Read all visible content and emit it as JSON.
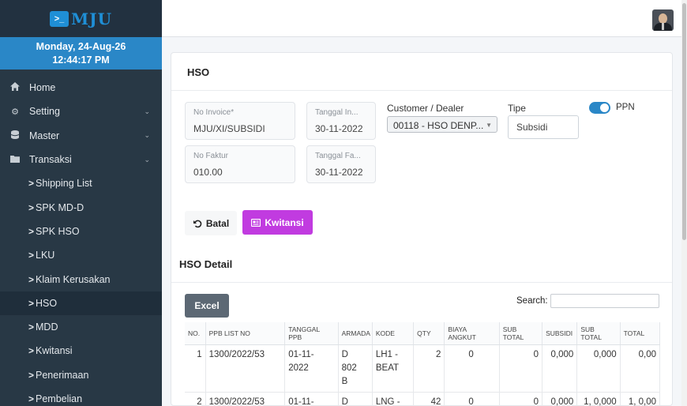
{
  "brand": {
    "logo_text": "MJU",
    "logo_icon": "terminal-icon"
  },
  "datetime": {
    "date": "Monday, 24-Aug-26",
    "time": "12:44:17 PM"
  },
  "nav": [
    {
      "label": "Home",
      "icon": "home-icon",
      "type": "top"
    },
    {
      "label": "Setting",
      "icon": "gears-icon",
      "type": "top",
      "chevron": "⌄"
    },
    {
      "label": "Master",
      "icon": "database-icon",
      "type": "top",
      "chevron": "⌄"
    },
    {
      "label": "Transaksi",
      "icon": "folder-icon",
      "type": "top",
      "chevron": "⌄"
    },
    {
      "label": "Shipping List",
      "type": "sub"
    },
    {
      "label": "SPK MD-D",
      "type": "sub"
    },
    {
      "label": "SPK HSO",
      "type": "sub"
    },
    {
      "label": "LKU",
      "type": "sub"
    },
    {
      "label": "Klaim Kerusakan",
      "type": "sub"
    },
    {
      "label": "HSO",
      "type": "sub",
      "active": true
    },
    {
      "label": "MDD",
      "type": "sub"
    },
    {
      "label": "Kwitansi",
      "type": "sub"
    },
    {
      "label": "Penerimaan",
      "type": "sub"
    },
    {
      "label": "Pembelian",
      "type": "sub"
    }
  ],
  "card": {
    "title": "HSO"
  },
  "form": {
    "no_invoice": {
      "label": "No Invoice*",
      "value": "MJU/XI/SUBSIDI"
    },
    "tanggal_invoice": {
      "label": "Tanggal In...",
      "value": "30-11-2022"
    },
    "no_faktur": {
      "label": "No Faktur",
      "value": "010.00"
    },
    "tanggal_faktur": {
      "label": "Tanggal Fa...",
      "value": "30-11-2022"
    },
    "customer": {
      "label": "Customer / Dealer",
      "value": "00118 - HSO DENP..."
    },
    "tipe": {
      "label": "Tipe",
      "value": "Subsidi"
    },
    "ppn": {
      "label": "PPN",
      "on": true
    }
  },
  "buttons": {
    "batal": "Batal",
    "kwitansi": "Kwitansi",
    "excel": "Excel"
  },
  "detail": {
    "title": "HSO Detail",
    "search_label": "Search:",
    "columns": [
      "NO.",
      "PPB LIST NO",
      "TANGGAL PPB",
      "ARMADA",
      "KODE",
      "QTY",
      "BIAYA ANGKUT",
      "SUB TOTAL",
      "SUBSIDI",
      "SUB TOTAL",
      "TOTAL"
    ],
    "rows": [
      {
        "no": "1",
        "ppb": "1300/2022/53",
        "tanggal_a": "01-11-",
        "tanggal_b": "2022",
        "armada_a": "D",
        "armada_b": "802",
        "armada_c": "B",
        "kode_a": "LH1 -",
        "kode_b": "BEAT",
        "qty": "2",
        "biaya": "0",
        "sub_total": "0",
        "subsidi": "0,000",
        "sub_total2": "0,000",
        "total": "0,00"
      },
      {
        "no": "2",
        "ppb": "1300/2022/53",
        "tanggal_a": "01-11-",
        "tanggal_b": "",
        "armada_a": "D",
        "armada_b": "",
        "armada_c": "",
        "kode_a": "LNG -",
        "kode_b": "",
        "qty": "42",
        "biaya": "0",
        "sub_total": "0",
        "subsidi": "0,000",
        "sub_total2": "1, 0,000",
        "total": "1, 0,00"
      }
    ]
  }
}
